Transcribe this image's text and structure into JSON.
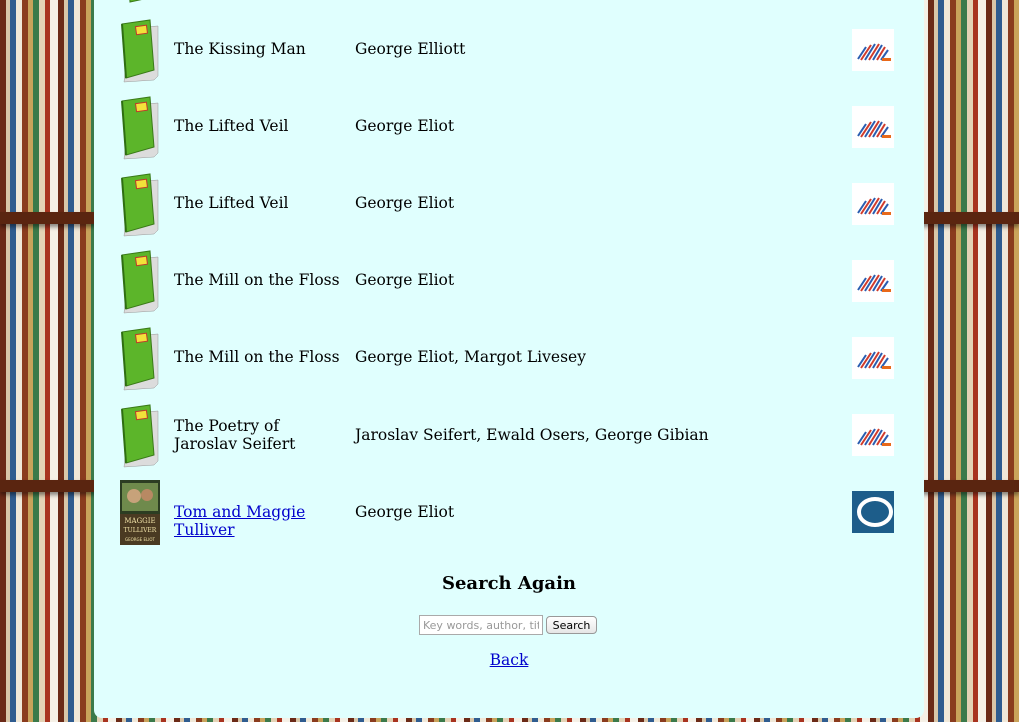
{
  "rows": [
    {
      "title": "The Kissing Man",
      "author": "George Elliott",
      "title_link": false,
      "cover": "green-book-icon",
      "source": "library-fan-logo"
    },
    {
      "title": "The Lifted Veil",
      "author": "George Eliot",
      "title_link": false,
      "cover": "green-book-icon",
      "source": "library-fan-logo"
    },
    {
      "title": "The Lifted Veil",
      "author": "George Eliot",
      "title_link": false,
      "cover": "green-book-icon",
      "source": "library-fan-logo"
    },
    {
      "title": "The Mill on the Floss",
      "author": "George Eliot",
      "title_link": false,
      "cover": "green-book-icon",
      "source": "library-fan-logo"
    },
    {
      "title": "The Mill on the Floss",
      "author": "George Eliot, Margot Livesey",
      "title_link": false,
      "cover": "green-book-icon",
      "source": "library-fan-logo"
    },
    {
      "title": "The Poetry of Jaroslav Seifert",
      "author": "Jaroslav Seifert, Ewald Osers, George Gibian",
      "title_link": false,
      "cover": "green-book-icon",
      "source": "library-fan-logo"
    },
    {
      "title": "Tom and Maggie Tulliver",
      "author": "George Eliot",
      "title_link": true,
      "cover": "book-cover-image",
      "source": "overdrive-logo"
    }
  ],
  "cover_art": {
    "line1": "MAGGIE",
    "line2": "TULLIVER",
    "line3": "GEORGE ELIOT"
  },
  "search": {
    "heading": "Search Again",
    "placeholder": "Key words, author, title",
    "button_label": "Search"
  },
  "back_label": "Back",
  "colors": {
    "panel": "#e0fffe",
    "link": "#0000cc",
    "book_green": "#5cb52a"
  }
}
